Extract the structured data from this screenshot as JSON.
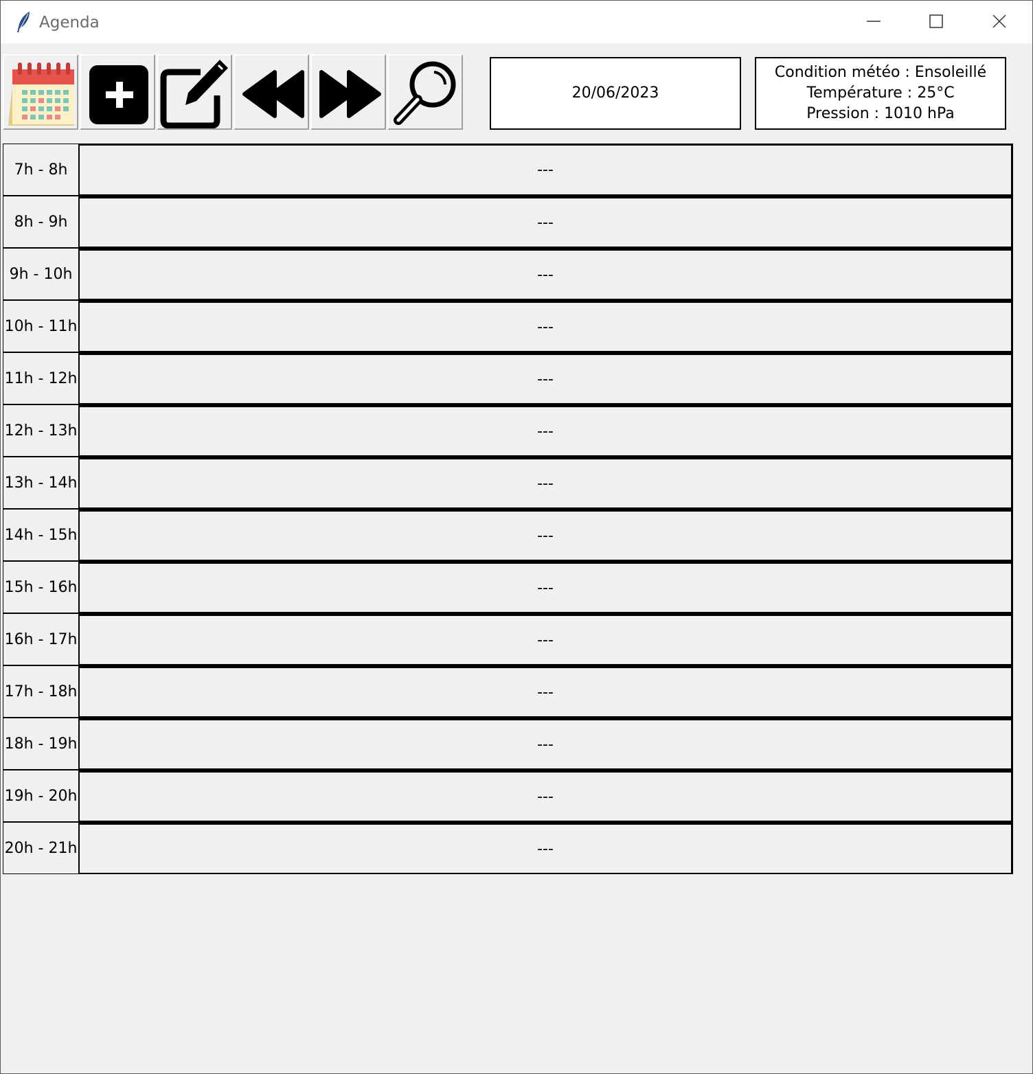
{
  "window": {
    "title": "Agenda",
    "minimize_icon": "minimize-icon",
    "maximize_icon": "maximize-icon",
    "close_icon": "close-icon"
  },
  "toolbar": {
    "buttons": [
      {
        "name": "calendar",
        "icon": "calendar-icon"
      },
      {
        "name": "add",
        "icon": "plus-icon"
      },
      {
        "name": "edit",
        "icon": "edit-icon"
      },
      {
        "name": "previous",
        "icon": "rewind-icon"
      },
      {
        "name": "next",
        "icon": "fast-forward-icon"
      },
      {
        "name": "search",
        "icon": "search-icon"
      }
    ]
  },
  "date": "20/06/2023",
  "weather": {
    "condition": "Condition météo : Ensoleillé",
    "temperature": "Température : 25°C",
    "pressure": "Pression : 1010 hPa"
  },
  "agenda": {
    "slots": [
      {
        "time": "7h - 8h",
        "event": "---"
      },
      {
        "time": "8h - 9h",
        "event": "---"
      },
      {
        "time": "9h - 10h",
        "event": "---"
      },
      {
        "time": "10h - 11h",
        "event": "---"
      },
      {
        "time": "11h - 12h",
        "event": "---"
      },
      {
        "time": "12h - 13h",
        "event": "---"
      },
      {
        "time": "13h - 14h",
        "event": "---"
      },
      {
        "time": "14h - 15h",
        "event": "---"
      },
      {
        "time": "15h - 16h",
        "event": "---"
      },
      {
        "time": "16h - 17h",
        "event": "---"
      },
      {
        "time": "17h - 18h",
        "event": "---"
      },
      {
        "time": "18h - 19h",
        "event": "---"
      },
      {
        "time": "19h - 20h",
        "event": "---"
      },
      {
        "time": "20h - 21h",
        "event": "---"
      }
    ]
  }
}
